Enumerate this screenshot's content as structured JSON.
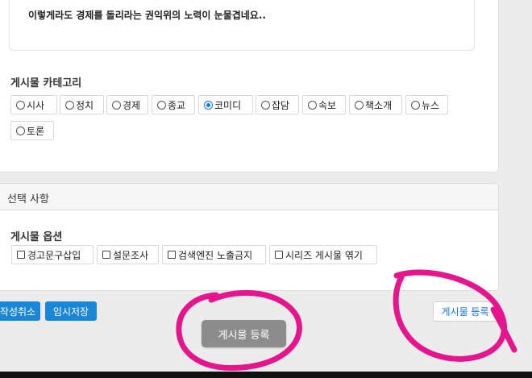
{
  "editor": {
    "content": "이렇게라도 경제를 돌리라는 권익위의 노력이 눈물겹네요.."
  },
  "category": {
    "label": "게시물 카테고리",
    "selected": "코미디",
    "options": [
      {
        "label": "시사",
        "checked": false
      },
      {
        "label": "정치",
        "checked": false
      },
      {
        "label": "경제",
        "checked": false
      },
      {
        "label": "종교",
        "checked": false
      },
      {
        "label": "코미디",
        "checked": true
      },
      {
        "label": "잡담",
        "checked": false
      },
      {
        "label": "속보",
        "checked": false
      },
      {
        "label": "책소개",
        "checked": false
      },
      {
        "label": "뉴스",
        "checked": false
      },
      {
        "label": "토론",
        "checked": false
      }
    ]
  },
  "options_section": {
    "header": "선택 사항",
    "label": "게시물 옵션",
    "checkboxes": [
      {
        "label": "경고문구삽입",
        "checked": false
      },
      {
        "label": "설문조사",
        "checked": false
      },
      {
        "label": "검색엔진 노출금지",
        "checked": false
      },
      {
        "label": "시리즈 게시물 엮기",
        "checked": false
      }
    ]
  },
  "actions": {
    "cancel_label": "작성취소",
    "draft_label": "임시저장",
    "submit_label": "게시물 등록",
    "submit_label_secondary": "게시물 등록"
  },
  "colors": {
    "accent_blue": "#1a86d6",
    "annotation_magenta": "#e5168c",
    "submit_gray": "#8c8c8c"
  }
}
